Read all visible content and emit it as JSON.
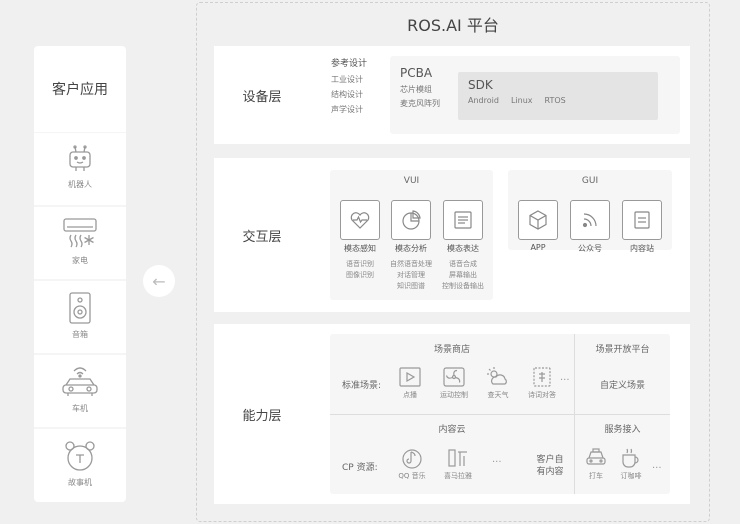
{
  "platform": {
    "title": "ROS.AI 平台"
  },
  "client": {
    "title": "客户应用",
    "items": [
      {
        "label": "机器人",
        "icon": "robot-icon"
      },
      {
        "label": "家电",
        "icon": "air-conditioner-icon"
      },
      {
        "label": "音箱",
        "icon": "speaker-icon"
      },
      {
        "label": "车机",
        "icon": "car-icon"
      },
      {
        "label": "故事机",
        "icon": "story-machine-icon"
      }
    ]
  },
  "device_layer": {
    "name": "设备层",
    "design": {
      "title": "参考设计",
      "items": [
        "工业设计",
        "结构设计",
        "声学设计"
      ]
    },
    "pcba": {
      "title": "PCBA",
      "items": [
        "芯片模组",
        "麦克风阵列"
      ]
    },
    "sdk": {
      "title": "SDK",
      "items": [
        "Android",
        "Linux",
        "RTOS"
      ]
    }
  },
  "interaction_layer": {
    "name": "交互层",
    "vui": {
      "title": "VUI",
      "items": [
        {
          "label": "模态感知",
          "icon": "heart-wave-icon",
          "subs": [
            "语音识别",
            "图像识别"
          ]
        },
        {
          "label": "模态分析",
          "icon": "pie-chart-icon",
          "subs": [
            "自然语音处理",
            "对话管理",
            "知识图谱"
          ]
        },
        {
          "label": "模态表达",
          "icon": "document-icon",
          "subs": [
            "语音合成",
            "屏幕输出",
            "控制设备输出"
          ]
        }
      ]
    },
    "gui": {
      "title": "GUI",
      "items": [
        {
          "label": "APP",
          "icon": "cube-icon"
        },
        {
          "label": "公众号",
          "icon": "rss-icon"
        },
        {
          "label": "内容站",
          "icon": "content-icon"
        }
      ]
    }
  },
  "capability_layer": {
    "name": "能力层",
    "scene_store": {
      "title": "场景商店",
      "label": "标准场景:",
      "items": [
        {
          "label": "点播",
          "icon": "play-icon"
        },
        {
          "label": "运动控制",
          "icon": "fan-icon"
        },
        {
          "label": "查天气",
          "icon": "weather-icon"
        },
        {
          "label": "诗词对答",
          "icon": "poem-icon"
        }
      ],
      "more": "..."
    },
    "scene_platform": {
      "title": "场景开放平台",
      "label": "自定义场景"
    },
    "content_cloud": {
      "title": "内容云",
      "label": "CP 资源:",
      "items": [
        {
          "label": "QQ 音乐",
          "icon": "qq-music-icon"
        },
        {
          "label": "喜马拉雅",
          "icon": "ximalaya-icon"
        }
      ],
      "more": "...",
      "own_content": "客户自\n有内容"
    },
    "service": {
      "title": "服务接入",
      "items": [
        {
          "label": "打车",
          "icon": "taxi-icon"
        },
        {
          "label": "订咖啡",
          "icon": "coffee-icon"
        }
      ],
      "more": "..."
    }
  }
}
